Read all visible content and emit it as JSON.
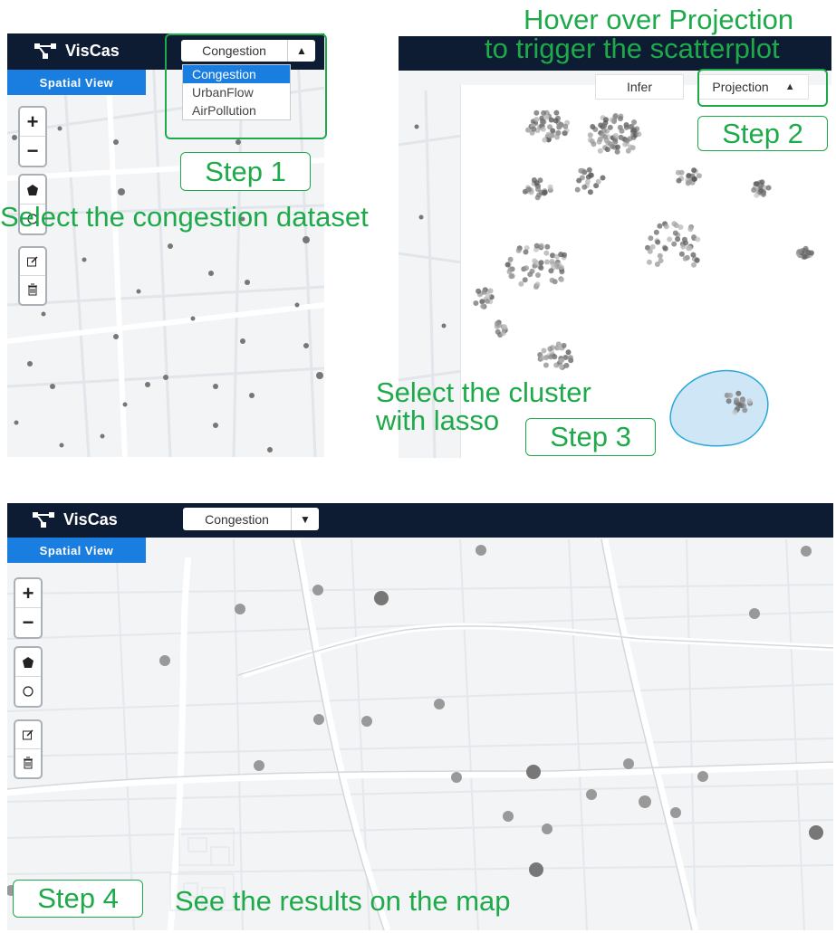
{
  "app": {
    "name": "VisCas"
  },
  "dataset_select": {
    "value": "Congestion",
    "options": [
      "Congestion",
      "UrbanFlow",
      "AirPollution"
    ]
  },
  "spatial_view_label": "Spatial View",
  "map_controls": {
    "zoom_in": "+",
    "zoom_out": "−"
  },
  "projection_panel": {
    "tabs": [
      "Infer",
      "Projection"
    ]
  },
  "steps": {
    "step1": "Step 1",
    "step2": "Step 2",
    "step3": "Step 3",
    "step4": "Step 4"
  },
  "annotations": {
    "select_dataset": "Select the congestion dataset",
    "hover_line1": "Hover over Projection",
    "hover_line2": "to trigger the scatterplot",
    "lasso_line1": "Select the cluster",
    "lasso_line2": "with lasso",
    "results": "See the results on the map"
  },
  "colors": {
    "navbar": "#0d1b33",
    "accent_blue": "#1a7de0",
    "annotation_green": "#1eaa4a",
    "lasso_fill": "#cfe6f7",
    "lasso_stroke": "#2aa7d9"
  }
}
